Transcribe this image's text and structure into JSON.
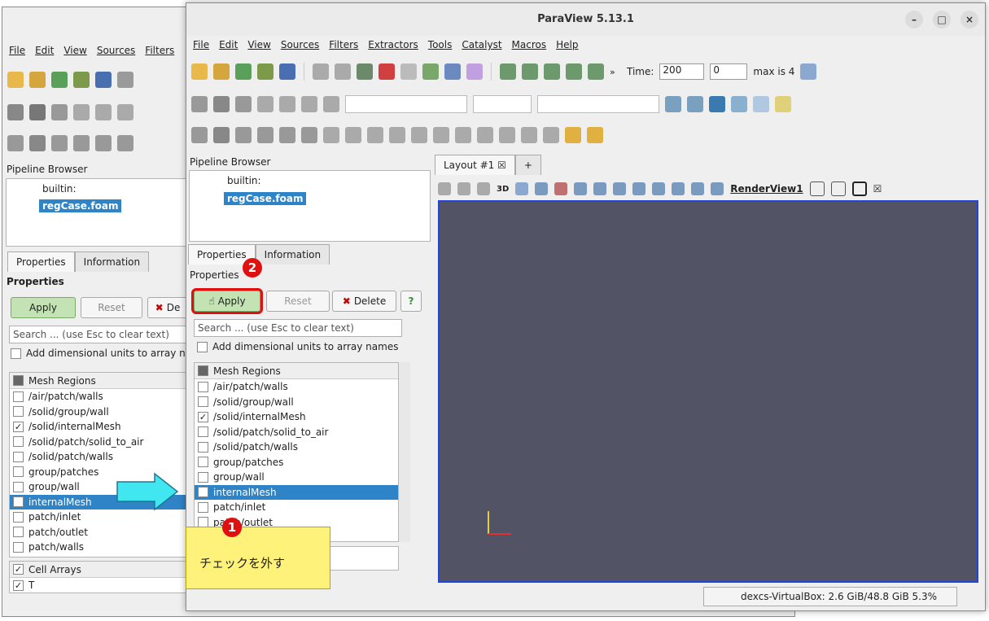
{
  "window": {
    "title": "ParaView 5.13.1",
    "minimize": "–",
    "maximize": "□",
    "close": "×"
  },
  "menu": [
    "File",
    "Edit",
    "View",
    "Sources",
    "Filters",
    "Extractors",
    "Tools",
    "Catalyst",
    "Macros",
    "Help"
  ],
  "bg_menu": [
    "File",
    "Edit",
    "View",
    "Sources",
    "Filters"
  ],
  "time": {
    "label": "Time:",
    "value": "200",
    "index": "0",
    "max": "max is 4"
  },
  "pipeline": {
    "title": "Pipeline Browser",
    "root": "builtin:",
    "item": "regCase.foam"
  },
  "tabs": {
    "properties": "Properties",
    "information": "Information"
  },
  "properties": {
    "header": "Properties",
    "apply": "Apply",
    "reset": "Reset",
    "delete": "Delete",
    "help": "?",
    "search_placeholder": "Search ... (use Esc to clear text)",
    "dim_units": "Add dimensional units to array names",
    "bg_dim_units": "Add dimensional units to array nar",
    "bg_delete": "De"
  },
  "mesh_regions": {
    "title": "Mesh Regions",
    "items": [
      {
        "label": "/air/patch/walls",
        "checked": false
      },
      {
        "label": "/solid/group/wall",
        "checked": false
      },
      {
        "label": "/solid/internalMesh",
        "checked": true
      },
      {
        "label": "/solid/patch/solid_to_air",
        "checked": false
      },
      {
        "label": "/solid/patch/walls",
        "checked": false
      },
      {
        "label": "group/patches",
        "checked": false
      },
      {
        "label": "group/wall",
        "checked": false
      },
      {
        "label": "internalMesh",
        "checked": false
      },
      {
        "label": "patch/inlet",
        "checked": false
      },
      {
        "label": "patch/outlet",
        "checked": false
      },
      {
        "label": "patch/walls",
        "checked": false
      }
    ]
  },
  "bg_mesh_internal_checked": "✓",
  "cell_arrays": {
    "title": "Cell Arrays",
    "first": "T"
  },
  "layout": {
    "tab": "Layout #1",
    "add": "+",
    "view": "RenderView1",
    "mode3d": "3D"
  },
  "status": {
    "memory": "dexcs-VirtualBox: 2.6 GiB/48.8 GiB 5.3%"
  },
  "annotations": {
    "callout_text": "チェックを外す",
    "badge1": "1",
    "badge2": "2"
  },
  "colors": {
    "accent": "#2f83c7",
    "apply_bg": "#c4e3b4",
    "render_bg": "#525466",
    "highlight": "#e01010",
    "callout": "#fff27a",
    "arrow": "#40e6f0"
  }
}
